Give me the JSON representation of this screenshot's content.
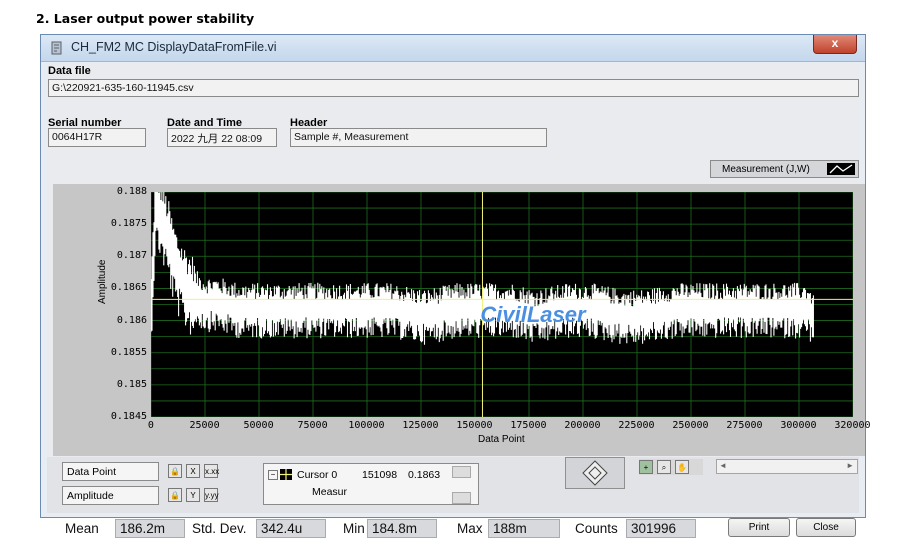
{
  "heading": "2.   Laser output power stability",
  "window": {
    "title": "CH_FM2 MC DisplayDataFromFile.vi",
    "close_glyph": "x"
  },
  "data_file": {
    "label": "Data file",
    "value": "G:\\220921-635-160-11945.csv"
  },
  "serial": {
    "label": "Serial number",
    "value": "0064H17R"
  },
  "datetime": {
    "label": "Date and Time",
    "value": "2022 九月 22 08:09"
  },
  "header": {
    "label": "Header",
    "value": "Sample #, Measurement"
  },
  "legend": {
    "label": "Measurement (J,W)"
  },
  "watermark": "CivilLaser",
  "chart_data": {
    "type": "line",
    "xlabel": "Data Point",
    "ylabel": "Amplitude",
    "xlim": [
      0,
      320000
    ],
    "ylim": [
      0.1845,
      0.188
    ],
    "x_ticks": [
      "0",
      "25000",
      "50000",
      "75000",
      "100000",
      "125000",
      "150000",
      "175000",
      "200000",
      "225000",
      "250000",
      "275000",
      "300000",
      "320000"
    ],
    "y_ticks": [
      "0.188",
      "0.1875",
      "0.187",
      "0.1865",
      "0.186",
      "0.1855",
      "0.185",
      "0.1845"
    ],
    "grid": true,
    "series": [
      {
        "name": "Measurement (J,W)",
        "x": [
          0,
          2000,
          4000,
          6000,
          8000,
          10000,
          12000,
          15000,
          20000,
          25000,
          30000,
          40000,
          50000,
          60000,
          75000,
          90000,
          100000,
          110000,
          125000,
          140000,
          150000,
          165000,
          175000,
          190000,
          200000,
          215000,
          225000,
          240000,
          250000,
          265000,
          275000,
          290000,
          300000,
          301996
        ],
        "values": [
          0.1862,
          0.1878,
          0.1877,
          0.1875,
          0.1873,
          0.187,
          0.1868,
          0.1866,
          0.1864,
          0.1863,
          0.1863,
          0.1862,
          0.1862,
          0.1862,
          0.1862,
          0.1862,
          0.1862,
          0.1862,
          0.1861,
          0.1862,
          0.1862,
          0.1862,
          0.1861,
          0.1862,
          0.1862,
          0.1861,
          0.1861,
          0.1862,
          0.1862,
          0.1862,
          0.1862,
          0.1862,
          0.1862,
          0.186
        ]
      }
    ],
    "mean_line": 0.18633,
    "cursor_x": 151098
  },
  "axes_panel": {
    "x_name": "Data Point",
    "y_name": "Amplitude",
    "x_fmt": "x.xx",
    "y_fmt": "y.yy"
  },
  "cursor": {
    "name": "Cursor 0",
    "x": "151098",
    "y": "0.1863",
    "sub": "Measur"
  },
  "stats": {
    "mean_label": "Mean",
    "mean": "186.2m",
    "std_label": "Std. Dev.",
    "std": "342.4u",
    "min_label": "Min",
    "min": "184.8m",
    "max_label": "Max",
    "max": "188m",
    "counts_label": "Counts",
    "counts": "301996"
  },
  "buttons": {
    "print": "Print",
    "close": "Close"
  },
  "colors": {
    "plot_bg": "#000000",
    "grid": "#1f6b1f",
    "trace": "#ffffff",
    "cursor": "#f2f27a",
    "watermark": "#4b8fe0"
  }
}
